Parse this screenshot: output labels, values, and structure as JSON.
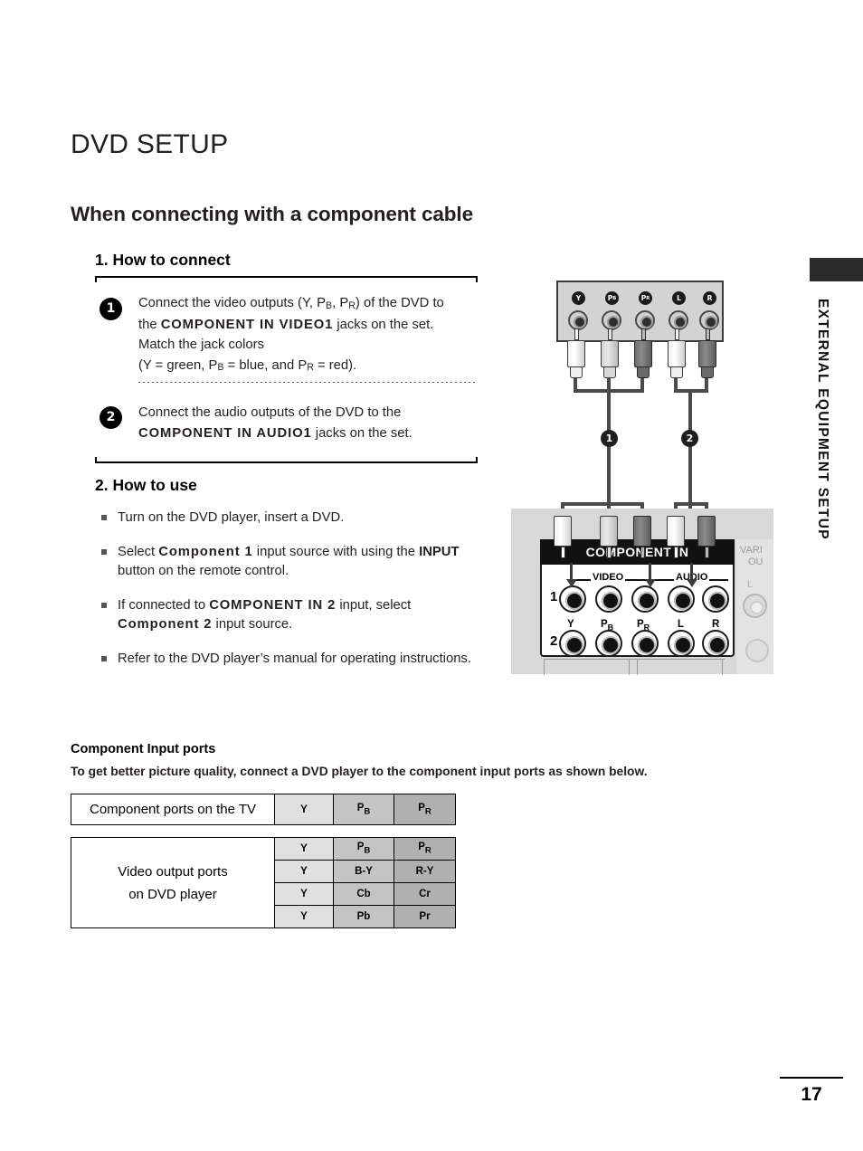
{
  "page": {
    "title": "DVD SETUP",
    "subtitle": "When connecting with a component cable",
    "number": "17",
    "side_label": "EXTERNAL EQUIPMENT SETUP"
  },
  "section_connect": {
    "heading": "1. How to connect",
    "steps": [
      {
        "badge": "1",
        "line1_a": "Connect the video outputs (Y, P",
        "line1_sub1": "B",
        "line1_b": ", P",
        "line1_sub2": "R",
        "line1_c": ")  of the DVD  to",
        "line2_a": "the ",
        "line2_bold": "COMPONENT IN VIDEO1",
        "line2_b": " jacks on the set.",
        "line3": "Match the jack colors",
        "line4_a": "(Y = green, P",
        "line4_sub1": "B",
        "line4_b": " = blue, and P",
        "line4_sub2": "R",
        "line4_c": " = red)."
      },
      {
        "badge": "2",
        "line1": "Connect the audio outputs of the DVD to the",
        "line2_bold": "COMPONENT IN AUDIO1",
        "line2_b": " jacks on the set."
      }
    ]
  },
  "section_use": {
    "heading": "2. How to use",
    "bullets": [
      {
        "t1": "Turn on the DVD player, insert a DVD."
      },
      {
        "t1": "Select ",
        "b1": "Component 1",
        "t2": " input source with using the ",
        "b2": "INPUT",
        "t3": "button on the remote control."
      },
      {
        "t1": "If connected to ",
        "b1": "COMPONENT IN 2",
        "t2": " input, select",
        "b2": "Component 2",
        "t3": " input source."
      },
      {
        "t1": "Refer to the DVD player’s manual for operating instructions."
      }
    ]
  },
  "ports": {
    "heading": "Component Input ports",
    "subheading": "To get better picture quality, connect a DVD player to the component input ports as shown below.",
    "tv_row": {
      "label": "Component ports on the TV",
      "y": "Y",
      "pb_main": "P",
      "pb_sub": "B",
      "pr_main": "P",
      "pr_sub": "R"
    },
    "dvd_table": {
      "label_line1": "Video output ports",
      "label_line2": "on DVD player",
      "rows": [
        {
          "y": "Y",
          "pb_main": "P",
          "pb_sub": "B",
          "pr_main": "P",
          "pr_sub": "R"
        },
        {
          "y": "Y",
          "pb_main": "B-Y",
          "pb_sub": "",
          "pr_main": "R-Y",
          "pr_sub": ""
        },
        {
          "y": "Y",
          "pb_main": "Cb",
          "pb_sub": "",
          "pr_main": "Cr",
          "pr_sub": ""
        },
        {
          "y": "Y",
          "pb_main": "Pb",
          "pb_sub": "",
          "pr_main": "Pr",
          "pr_sub": ""
        }
      ]
    }
  },
  "diagram": {
    "dvd_jack_labels": [
      {
        "main": "Y",
        "sub": ""
      },
      {
        "main": "P",
        "sub": "B"
      },
      {
        "main": "P",
        "sub": "R"
      },
      {
        "main": "L",
        "sub": ""
      },
      {
        "main": "R",
        "sub": ""
      }
    ],
    "cable_badges": [
      "1",
      "2"
    ],
    "tv_panel": {
      "title": "COMPONENT IN",
      "group_video": "VIDEO",
      "group_audio": "AUDIO",
      "row1": "1",
      "row2": "2",
      "jack_labels": [
        {
          "main": "Y",
          "sub": ""
        },
        {
          "main": "P",
          "sub": "B"
        },
        {
          "main": "P",
          "sub": "R"
        },
        {
          "main": "L",
          "sub": ""
        },
        {
          "main": "R",
          "sub": ""
        }
      ]
    },
    "variable_out": {
      "line1": "VARI",
      "line2": "OU",
      "l_label": "L"
    }
  }
}
